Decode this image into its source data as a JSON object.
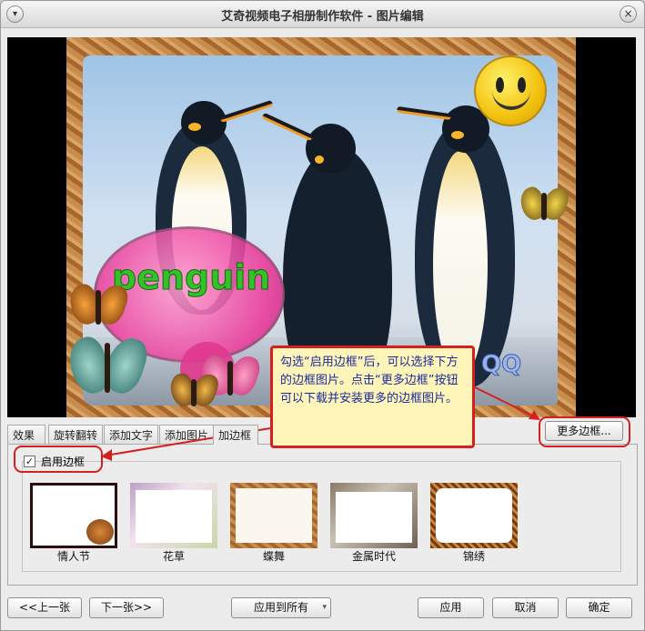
{
  "window": {
    "title": "艾奇视频电子相册制作软件 - 图片编辑"
  },
  "preview": {
    "bubble_text": "penguin",
    "watermark": "QQ"
  },
  "tabs": [
    {
      "label": "效果"
    },
    {
      "label": "旋转翻转"
    },
    {
      "label": "添加文字"
    },
    {
      "label": "添加图片"
    },
    {
      "label": "加边框",
      "active": true
    }
  ],
  "border_panel": {
    "enable_label": "启用边框",
    "enable_checked": true,
    "more_button": "更多边框...",
    "frames": [
      {
        "label": "情人节"
      },
      {
        "label": "花草"
      },
      {
        "label": "蝶舞"
      },
      {
        "label": "金属时代"
      },
      {
        "label": "锦绣"
      }
    ]
  },
  "callout": {
    "text": "勾选“启用边框”后，可以选择下方的边框图片。点击“更多边框”按钮可以下载并安装更多的边框图片。"
  },
  "footer": {
    "prev": "<<上一张",
    "next": "下一张>>",
    "apply_all": "应用到所有",
    "apply": "应用",
    "cancel": "取消",
    "ok": "确定"
  },
  "colors": {
    "accent_red": "#d42020",
    "callout_bg": "#fff5b8",
    "callout_text": "#1a2a9c"
  }
}
